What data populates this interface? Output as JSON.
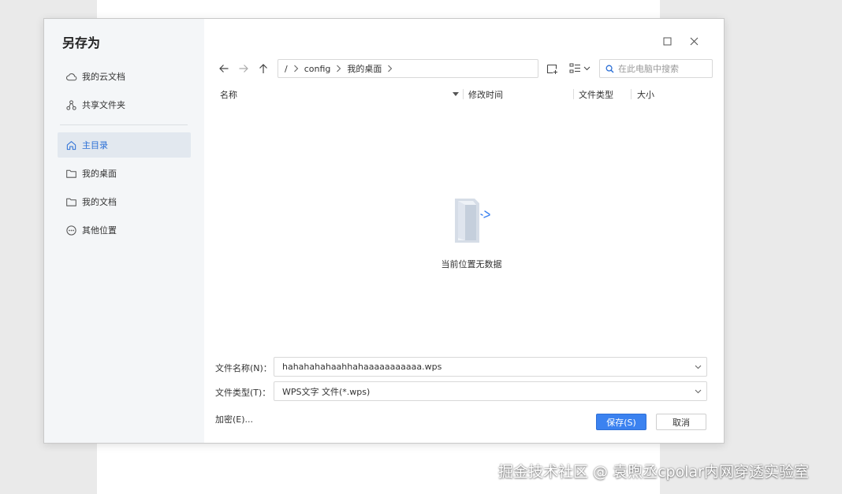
{
  "dialog": {
    "title": "另存为",
    "sidebar": {
      "items": [
        {
          "label": "我的云文档",
          "icon": "cloud-icon"
        },
        {
          "label": "共享文件夹",
          "icon": "share-icon"
        },
        {
          "label": "主目录",
          "icon": "home-icon",
          "active": true
        },
        {
          "label": "我的桌面",
          "icon": "folder-icon"
        },
        {
          "label": "我的文档",
          "icon": "folder-icon"
        },
        {
          "label": "其他位置",
          "icon": "more-icon"
        }
      ]
    },
    "path": {
      "root": "/",
      "segments": [
        "config",
        "我的桌面"
      ]
    },
    "search": {
      "placeholder": "在此电脑中搜索"
    },
    "columns": {
      "name": "名称",
      "modified": "修改时间",
      "type": "文件类型",
      "size": "大小"
    },
    "empty_text": "当前位置无数据",
    "filename": {
      "label": "文件名称(N)：",
      "value": "hahahahahaahhahaaaaaaaaaaa.wps"
    },
    "filetype": {
      "label": "文件类型(T)：",
      "value": "WPS文字 文件(*.wps)"
    },
    "encrypt_label": "加密(E)...",
    "save_label": "保存(S)",
    "cancel_label": "取消"
  },
  "watermark": "掘金技术社区 @ 袁煦丞cpolar内网穿透实验室",
  "colors": {
    "accent": "#3b82f0",
    "sidebar_bg": "#f4f6f8",
    "active_item_bg": "#e2e8ef"
  }
}
